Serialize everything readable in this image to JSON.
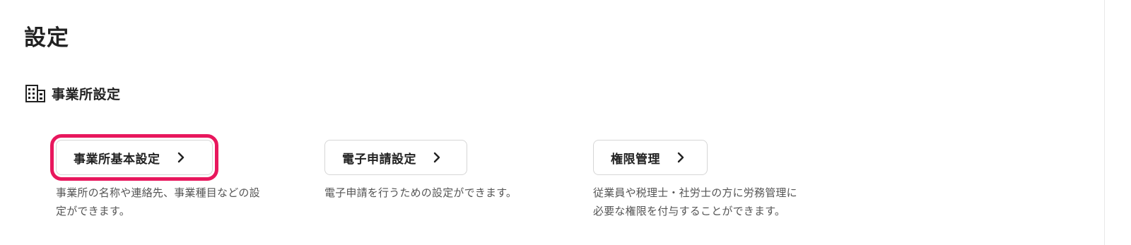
{
  "page": {
    "title": "設定"
  },
  "section": {
    "icon": "building-icon",
    "label": "事業所設定"
  },
  "cards": [
    {
      "label": "事業所基本設定",
      "icon": "chevron-right-icon",
      "highlighted": true,
      "highlight_color": "#e8175d",
      "desc_line1": "事業所の名称や連絡先、事業種目などの設",
      "desc_line2": "定ができます。"
    },
    {
      "label": "電子申請設定",
      "icon": "chevron-right-icon",
      "highlighted": false,
      "desc_line1": "電子申請を行うための設定ができます。",
      "desc_line2": ""
    },
    {
      "label": "権限管理",
      "icon": "chevron-right-icon",
      "highlighted": false,
      "desc_line1": "従業員や税理士・社労士の方に労務管理に",
      "desc_line2": "必要な権限を付与することができます。"
    }
  ]
}
